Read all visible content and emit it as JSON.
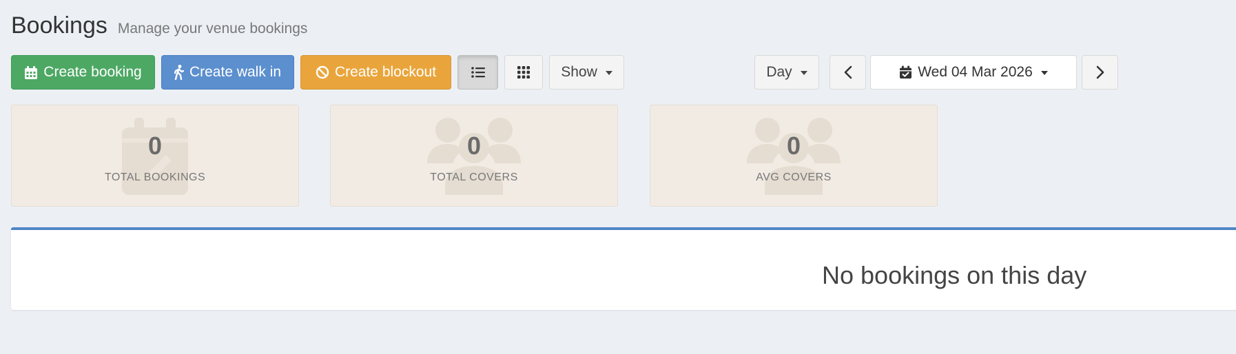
{
  "header": {
    "title": "Bookings",
    "subtitle": "Manage your venue bookings"
  },
  "toolbar": {
    "create_booking": "Create booking",
    "create_walk_in": "Create walk in",
    "create_blockout": "Create blockout",
    "show_label": "Show",
    "view_mode": "Day",
    "date_label": "Wed 04 Mar 2026"
  },
  "stats": [
    {
      "value": "0",
      "label": "TOTAL BOOKINGS",
      "icon": "calendar-icon"
    },
    {
      "value": "0",
      "label": "TOTAL COVERS",
      "icon": "users-icon"
    },
    {
      "value": "0",
      "label": "AVG COVERS",
      "icon": "users-icon"
    }
  ],
  "empty_state": {
    "message": "No bookings on this day"
  },
  "colors": {
    "success": "#4da864",
    "primary": "#5b8fce",
    "warning": "#e9a53b",
    "panel_accent": "#4f86c6",
    "stat_bg": "#f1ebe3"
  }
}
